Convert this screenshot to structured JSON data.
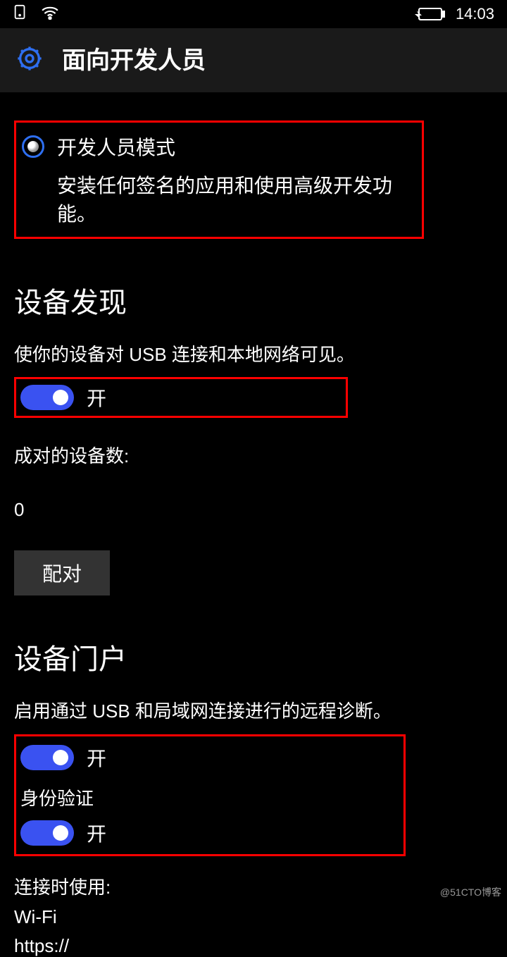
{
  "statusBar": {
    "time": "14:03"
  },
  "header": {
    "title": "面向开发人员"
  },
  "devMode": {
    "label": "开发人员模式",
    "desc": "安装任何签名的应用和使用高级开发功能。"
  },
  "deviceDiscovery": {
    "title": "设备发现",
    "desc": "使你的设备对 USB 连接和本地网络可见。",
    "toggleState": "开",
    "pairedLabel": "成对的设备数:",
    "pairedCount": "0",
    "pairButton": "配对"
  },
  "devicePortal": {
    "title": "设备门户",
    "desc": "启用通过 USB 和局域网连接进行的远程诊断。",
    "toggleState": "开",
    "authLabel": "身份验证",
    "authToggleState": "开",
    "connectLabel": "连接时使用:",
    "wifi": "Wi-Fi",
    "url": "https://"
  },
  "watermark": "@51CTO博客"
}
